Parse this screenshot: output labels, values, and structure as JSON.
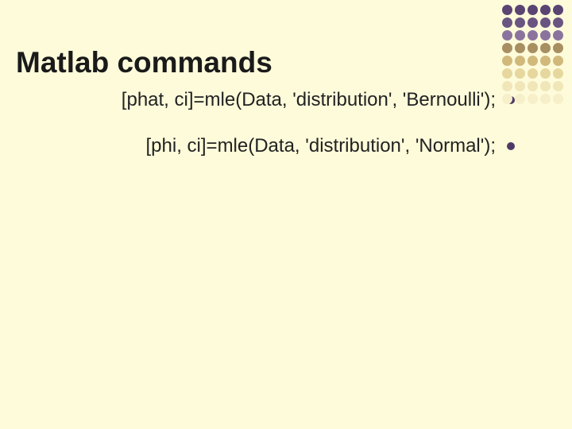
{
  "title": "Matlab commands",
  "bullets": [
    "[phat, ci]=mle(Data, 'distribution', 'Bernoulli');",
    "[phi, ci]=mle(Data, 'distribution', 'Normal');"
  ],
  "colors": {
    "bg": "#fdfbda",
    "text": "#1a1a1a",
    "bullet_dot": "#4f3a66"
  },
  "decor_dots": [
    [
      "#5a4472",
      "#5a4472",
      "#5a4472",
      "#5a4472",
      "#5a4472"
    ],
    [
      "#6a5482",
      "#6a5482",
      "#6a5482",
      "#6a5482",
      "#6a5482"
    ],
    [
      "#8a749e",
      "#8a749e",
      "#8a749e",
      "#8a749e",
      "#8a749e"
    ],
    [
      "#a78f61",
      "#a78f61",
      "#a78f61",
      "#a78f61",
      "#a78f61"
    ],
    [
      "#d0b97b",
      "#d0b97b",
      "#d0b97b",
      "#d0b97b",
      "#d0b97b"
    ],
    [
      "#e6d79e",
      "#e6d79e",
      "#e6d79e",
      "#e6d79e",
      "#e6d79e"
    ],
    [
      "#f0e6b8",
      "#f0e6b8",
      "#f0e6b8",
      "#f0e6b8",
      "#f0e6b8"
    ],
    [
      "#f6efca",
      "#f6efca",
      "#f6efca",
      "#f6efca",
      "#f6efca"
    ]
  ]
}
